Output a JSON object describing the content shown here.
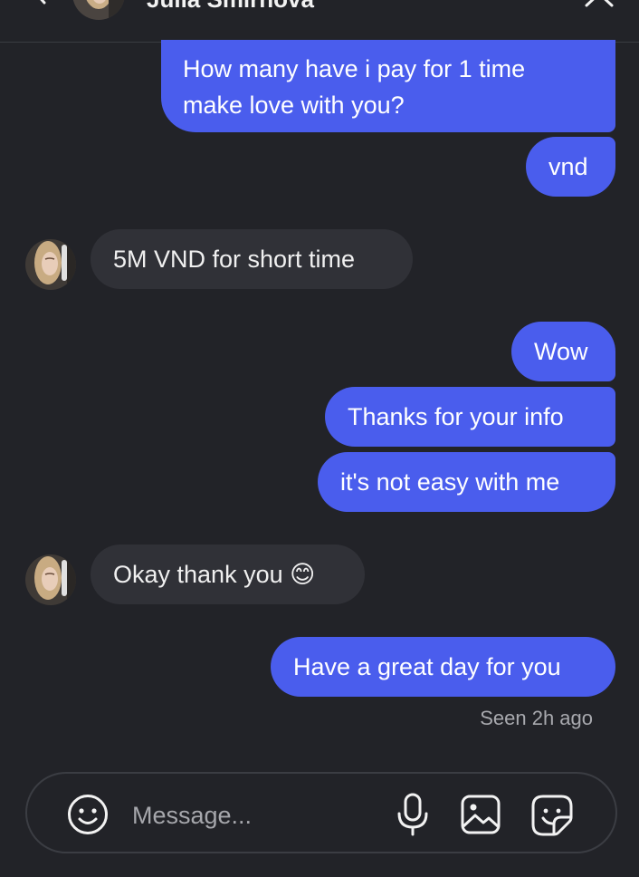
{
  "header": {
    "contact_name": "Julia Smirnova"
  },
  "messages": [
    {
      "id": "m1",
      "direction": "outgoing",
      "lines": [
        "How many have i pay for 1 time",
        "make love with you?"
      ]
    },
    {
      "id": "m2",
      "direction": "outgoing",
      "text": "vnd"
    },
    {
      "id": "m3",
      "direction": "incoming",
      "text": "5M VND for short time"
    },
    {
      "id": "m4",
      "direction": "outgoing",
      "text": "Wow"
    },
    {
      "id": "m5",
      "direction": "outgoing",
      "text": "Thanks for your info"
    },
    {
      "id": "m6",
      "direction": "outgoing",
      "text": "it's not easy with me"
    },
    {
      "id": "m7",
      "direction": "incoming",
      "text": "Okay thank you 😊"
    },
    {
      "id": "m8",
      "direction": "outgoing",
      "text": "Have a great day for you"
    }
  ],
  "status": {
    "seen": "Seen 2h ago"
  },
  "composer": {
    "placeholder": "Message..."
  },
  "icons": {
    "back": "chevron-left-icon",
    "minimize": "minimize-icon",
    "close": "close-icon",
    "emoji": "smiley-icon",
    "mic": "microphone-icon",
    "image": "image-icon",
    "sticker": "sticker-icon"
  },
  "colors": {
    "background": "#222328",
    "outgoing_bubble": "#4a5ded",
    "incoming_bubble": "#303137",
    "muted_text": "#a8a9ae"
  }
}
